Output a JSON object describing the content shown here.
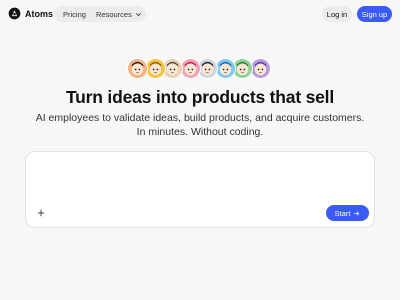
{
  "brand": {
    "name": "Atoms",
    "logo_icon": "atoms-logo-icon"
  },
  "nav": {
    "pricing_label": "Pricing",
    "resources_label": "Resources"
  },
  "auth": {
    "login_label": "Log in",
    "signup_label": "Sign up"
  },
  "avatars": [
    {
      "name": "avatar-1",
      "bg": "#f4b183",
      "accent": "#222222"
    },
    {
      "name": "avatar-2",
      "bg": "#f6c445",
      "accent": "#8a5a00"
    },
    {
      "name": "avatar-3",
      "bg": "#e6d2b5",
      "accent": "#5b4636"
    },
    {
      "name": "avatar-4",
      "bg": "#f4a3b4",
      "accent": "#c2185b"
    },
    {
      "name": "avatar-5",
      "bg": "#cfd6e3",
      "accent": "#222222"
    },
    {
      "name": "avatar-6",
      "bg": "#7ec8f2",
      "accent": "#1565c0"
    },
    {
      "name": "avatar-7",
      "bg": "#8fd39a",
      "accent": "#2e7d32"
    },
    {
      "name": "avatar-8",
      "bg": "#b39ddb",
      "accent": "#5e35b1"
    }
  ],
  "hero": {
    "headline": "Turn ideas into products that sell",
    "subline_1": "AI employees to validate ideas, build products, and acquire customers.",
    "subline_2": "In minutes. Without coding."
  },
  "prompt": {
    "value": "",
    "placeholder": "",
    "start_label": "Start"
  },
  "colors": {
    "accent": "#3b5bf6",
    "background": "#f7f7f8"
  }
}
